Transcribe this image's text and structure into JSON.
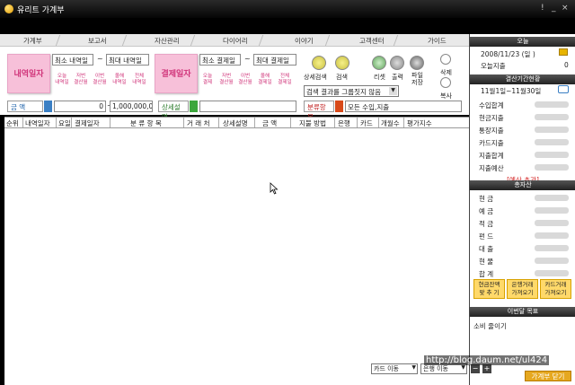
{
  "window": {
    "title": "유리트 가계부",
    "controls": [
      "!",
      "_",
      "×"
    ]
  },
  "tabs": [
    "가계부",
    "보고서",
    "자산관리",
    "다이어리",
    "이야기",
    "고객센터",
    "가이드"
  ],
  "search": {
    "transaction_date_label": "내역일자",
    "payment_date_label": "결제일자",
    "tx_from": "최소 내역일",
    "tx_to": "최대 내역일",
    "pay_from": "최소 결제일",
    "pay_to": "최대 결제일",
    "tilde": "~",
    "tx_quick": [
      "오늘\n내역일",
      "저번\n결산월",
      "이번\n결산월",
      "올해\n내역일",
      "전체\n내역일"
    ],
    "pay_quick": [
      "오늘\n결제",
      "저번\n결산월",
      "이번\n결산월",
      "올해\n결제일",
      "전체\n결제일"
    ],
    "detail_search": "상세검색",
    "search": "검색",
    "reset": "리셋",
    "print": "출력",
    "save_file": "파일\n저장",
    "delete": "삭제",
    "copy": "복사",
    "group_select": "검색 결과를 그룹짓지 않음",
    "amount_label": "금 액",
    "amount_from": "0",
    "amount_to": "1,000,000,000",
    "detail_label": "상세설명",
    "detail_value": "",
    "category_label": "분류항목",
    "category_value": "모든 수입,지출"
  },
  "table": {
    "columns": [
      "순위",
      "내역일자",
      "요일",
      "결제일자",
      "분 류 항 목",
      "거 래 처",
      "상세설명",
      "금 액",
      "지불 방법",
      "은행",
      "카드",
      "개월수",
      "평가지수"
    ]
  },
  "sidebar": {
    "today_header": "오늘",
    "today_date": "2008/11/23 (일 )",
    "today_expense_label": "오늘지출",
    "today_expense_value": "0",
    "period_header": "결산기간현황",
    "period_range": "11월1일~11월30일",
    "period_rows": [
      "수입합계",
      "현금지출",
      "통장지출",
      "카드지출",
      "지출합계",
      "지출예산"
    ],
    "over_budget": "[예산 초과]",
    "assets_header": "총자산",
    "asset_rows": [
      "현 금",
      "예 금",
      "적 금",
      "펀 드",
      "대 출",
      "현 물",
      "합 계"
    ],
    "btn_cash": "현금잔액\n맞 추 기",
    "btn_bank": "은행거래\n가져오기",
    "btn_card": "카드거래\n가져오기",
    "goal_header": "이번달 목표",
    "goal_text": "소비 줄이기"
  },
  "bottom": {
    "card_move": "카드 이동",
    "bank_move": "은행 이동",
    "minus": "−",
    "plus": "+",
    "watermark": "http://blog.daum.net/ul424",
    "close": "가계부 닫기"
  },
  "colors": {
    "accent_pink": "#d0347a",
    "header_dark": "#222222",
    "warn_red": "#d02020",
    "button_yellow": "#ffd96a"
  }
}
